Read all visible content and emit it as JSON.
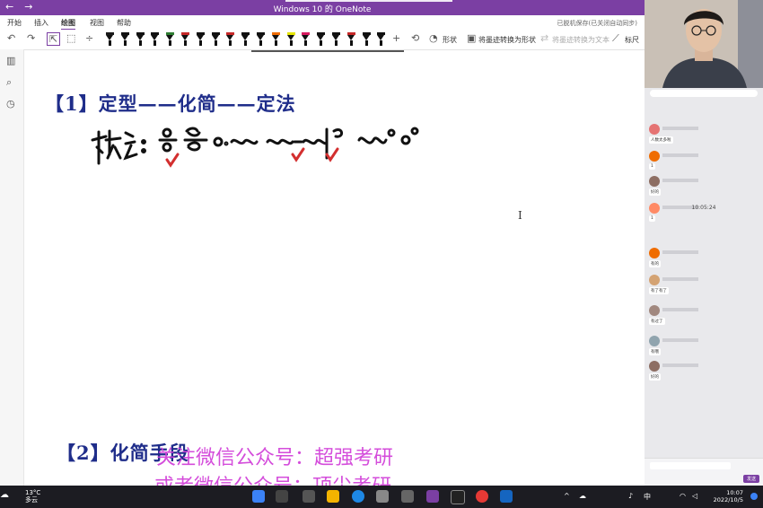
{
  "window": {
    "title": "Windows 10 的 OneNote",
    "back_glyph": "←",
    "forward_glyph": "→"
  },
  "menu": {
    "items": [
      "开始",
      "插入",
      "绘图",
      "视图",
      "帮助"
    ],
    "active": "绘图",
    "status": "已脱机保存(已关闭自动同步)"
  },
  "toolbar": {
    "undo_glyph": "↶",
    "redo_glyph": "↷",
    "lasso_glyph": "⬚",
    "plus_glyph": "+",
    "shape_label": "形状",
    "ink_to_shape_label": "将墨迹转换为形状",
    "ink_to_text_label": "将墨迹转换为文本",
    "ruler_label": "标尺",
    "pen_colors": [
      "#1a1a1a",
      "#111111",
      "#111111",
      "#111111",
      "#2e7d32",
      "#c62828",
      "#111111",
      "#111111",
      "#c62828",
      "#111111",
      "#111111",
      "#ef6c00",
      "#e5e500",
      "#d81b60",
      "#111111",
      "#111111",
      "#c62828",
      "#111111",
      "#111111"
    ]
  },
  "page": {
    "heading1": "【1】定型——化简——定法",
    "heading2": "【2】化简手段",
    "watermark_line1": "关注微信公众号：超强考研",
    "watermark_line2": "或者微信公众号：顶尖考研",
    "cursor_glyph": "I"
  },
  "chat": {
    "time_stamp": "10:05:24",
    "send_button": "发送",
    "messages": [
      {
        "text": "人数太多啦"
      },
      {
        "text": "1"
      },
      {
        "text": "好的"
      },
      {
        "text": "1"
      },
      {
        "text": "有的"
      },
      {
        "text": "有了有了"
      },
      {
        "text": "有过了"
      },
      {
        "text": "有哦"
      },
      {
        "text": "好的"
      }
    ]
  },
  "taskbar": {
    "weather_temp": "13°C",
    "weather_desc": "多云",
    "ime": "中",
    "time": "10:07",
    "date": "2022/10/5"
  },
  "colors": {
    "accent": "#7b3fa3",
    "heading": "#1f2d8a",
    "watermark": "#d03ad8",
    "taskbar": "#1c1c22"
  }
}
